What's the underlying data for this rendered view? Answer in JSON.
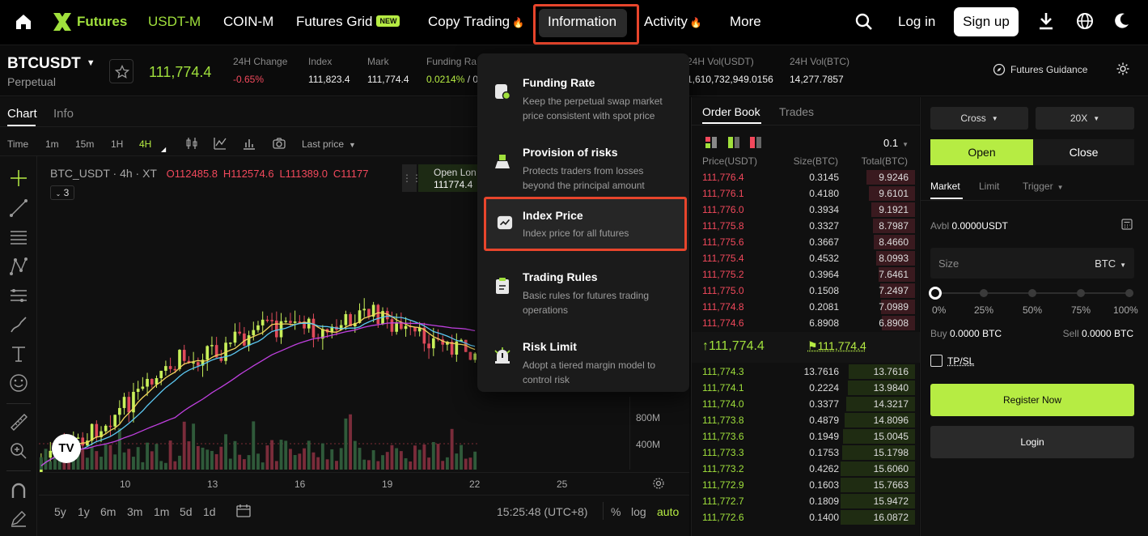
{
  "nav": {
    "logo": "Futures",
    "items": [
      "USDT-M",
      "COIN-M",
      "Futures Grid",
      "Copy Trading",
      "Information",
      "Activity",
      "More"
    ],
    "new_badge": "NEW",
    "login": "Log in",
    "signup": "Sign up"
  },
  "ticker": {
    "symbol": "BTCUSDT",
    "type": "Perpetual",
    "last_price": "111,774.4",
    "change_label": "24H Change",
    "change_value": "-0.65%",
    "index_label": "Index",
    "index_value": "111,823.4",
    "mark_label": "Mark",
    "mark_value": "111,774.4",
    "funding_label": "Funding Ra",
    "funding_value": "0.0214%",
    "funding_suffix": " / 0",
    "vol_usdt_label": "24H Vol(USDT)",
    "vol_usdt_value": "1,610,732,949.0156",
    "vol_btc_label": "24H Vol(BTC)",
    "vol_btc_value": "14,277.7857",
    "guidance": "Futures Guidance"
  },
  "chart": {
    "tabs": [
      "Chart",
      "Info"
    ],
    "timeframes": [
      "Time",
      "1m",
      "15m",
      "1H",
      "4H"
    ],
    "last_price_select": "Last price",
    "legend_symbol": "BTC_USDT · 4h · XT",
    "ohlc": {
      "o": "O112485.8",
      "h": "H112574.6",
      "l": "L111389.0",
      "c": "C11177"
    },
    "indicator_count": "3",
    "open_long_label": "Open Lon",
    "open_long_value": "111774.4",
    "vol_axis": [
      "800M",
      "400M"
    ],
    "x_ticks": [
      "10",
      "13",
      "16",
      "19",
      "22",
      "25"
    ],
    "ranges": [
      "5y",
      "1y",
      "6m",
      "3m",
      "1m",
      "5d",
      "1d"
    ],
    "clock": "15:25:48 (UTC+8)",
    "scale_opts": [
      "%",
      "log",
      "auto"
    ]
  },
  "dropdown": [
    {
      "title": "Funding Rate",
      "desc": "Keep the perpetual swap market price consistent with spot price"
    },
    {
      "title": "Provision of risks",
      "desc": "Protects traders from losses beyond the principal amount"
    },
    {
      "title": "Index Price",
      "desc": "Index price for all futures"
    },
    {
      "title": "Trading Rules",
      "desc": "Basic rules for futures trading operations"
    },
    {
      "title": "Risk Limit",
      "desc": "Adopt a tiered margin model to control risk"
    }
  ],
  "orderbook": {
    "tabs": [
      "Order Book",
      "Trades"
    ],
    "precision": "0.1",
    "headers": [
      "Price(USDT)",
      "Size(BTC)",
      "Total(BTC)"
    ],
    "asks": [
      {
        "p": "111,776.4",
        "s": "0.3145",
        "t": "9.9246",
        "d": 0.65
      },
      {
        "p": "111,776.1",
        "s": "0.4180",
        "t": "9.6101",
        "d": 0.62
      },
      {
        "p": "111,776.0",
        "s": "0.3934",
        "t": "9.1921",
        "d": 0.59
      },
      {
        "p": "111,775.8",
        "s": "0.3327",
        "t": "8.7987",
        "d": 0.57
      },
      {
        "p": "111,775.6",
        "s": "0.3667",
        "t": "8.4660",
        "d": 0.55
      },
      {
        "p": "111,775.4",
        "s": "0.4532",
        "t": "8.0993",
        "d": 0.52
      },
      {
        "p": "111,775.2",
        "s": "0.3964",
        "t": "7.6461",
        "d": 0.49
      },
      {
        "p": "111,775.0",
        "s": "0.1508",
        "t": "7.2497",
        "d": 0.47
      },
      {
        "p": "111,774.8",
        "s": "0.2081",
        "t": "7.0989",
        "d": 0.46
      },
      {
        "p": "111,774.6",
        "s": "6.8908",
        "t": "6.8908",
        "d": 0.45
      }
    ],
    "mid_price": "111,774.4",
    "mark_price": "111,774.4",
    "bids": [
      {
        "p": "111,774.3",
        "s": "13.7616",
        "t": "13.7616",
        "d": 0.89
      },
      {
        "p": "111,774.1",
        "s": "0.2224",
        "t": "13.9840",
        "d": 0.9
      },
      {
        "p": "111,774.0",
        "s": "0.3377",
        "t": "14.3217",
        "d": 0.92
      },
      {
        "p": "111,773.8",
        "s": "0.4879",
        "t": "14.8096",
        "d": 0.95
      },
      {
        "p": "111,773.6",
        "s": "0.1949",
        "t": "15.0045",
        "d": 0.97
      },
      {
        "p": "111,773.3",
        "s": "0.1753",
        "t": "15.1798",
        "d": 0.98
      },
      {
        "p": "111,773.2",
        "s": "0.4262",
        "t": "15.6060",
        "d": 1.0
      },
      {
        "p": "111,772.9",
        "s": "0.1603",
        "t": "15.7663",
        "d": 1.0
      },
      {
        "p": "111,772.7",
        "s": "0.1809",
        "t": "15.9472",
        "d": 1.0
      },
      {
        "p": "111,772.6",
        "s": "0.1400",
        "t": "16.0872",
        "d": 1.0
      }
    ]
  },
  "trade": {
    "margin_mode": "Cross",
    "leverage": "20X",
    "open": "Open",
    "close": "Close",
    "order_types": [
      "Market",
      "Limit",
      "Trigger"
    ],
    "avbl_label": "Avbl",
    "avbl_value": "0.0000USDT",
    "size_placeholder": "Size",
    "size_unit": "BTC",
    "slider_marks": [
      "0%",
      "25%",
      "50%",
      "75%",
      "100%"
    ],
    "slider_value": 0,
    "buy_label": "Buy",
    "buy_value": "0.0000 BTC",
    "sell_label": "Sell",
    "sell_value": "0.0000 BTC",
    "tpsl": "TP/SL",
    "register": "Register Now",
    "login": "Login"
  },
  "colors": {
    "accent": "#b6ec43",
    "up": "#a0e03c",
    "down": "#f2495c",
    "highlight": "#e8452c"
  }
}
